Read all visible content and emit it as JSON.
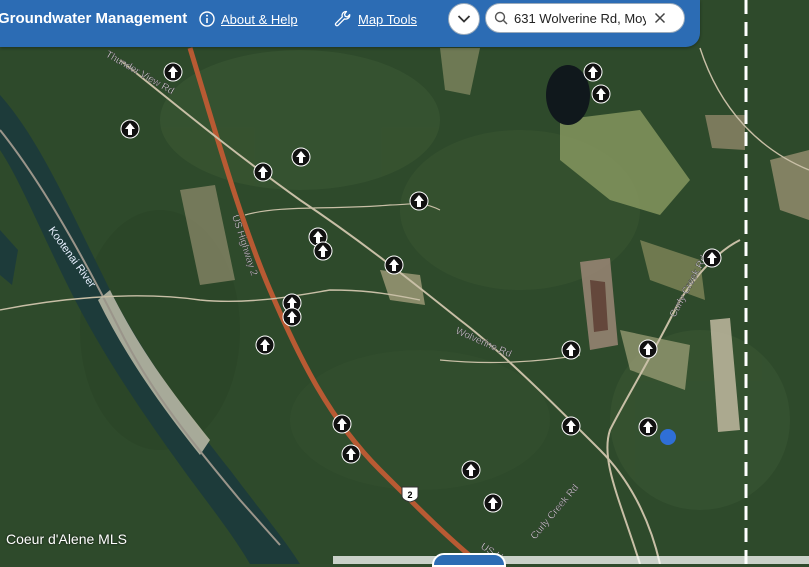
{
  "header": {
    "title": "Groundwater Management",
    "about_label": "About & Help",
    "tools_label": "Map Tools"
  },
  "search": {
    "value": "631 Wolverine Rd, Moy...",
    "placeholder": ""
  },
  "map": {
    "road_labels": {
      "thunder_view": "Thunder View Rd",
      "us_highway": "US Highway 2",
      "us_highway_bottom": "US H",
      "wolverine": "Wolverine Rd",
      "curly_creek_top": "Curly Creek Rd",
      "curly_creek_bottom": "Curly Creek Rd",
      "route_shield": "2"
    },
    "river_label": "Kootenai River",
    "credit": "Coeur d'Alene MLS",
    "colors": {
      "header": "#2c6cb4",
      "highway": "#b85a33",
      "selected_point": "#2f6fd6",
      "boundary": "#ffffff"
    }
  }
}
